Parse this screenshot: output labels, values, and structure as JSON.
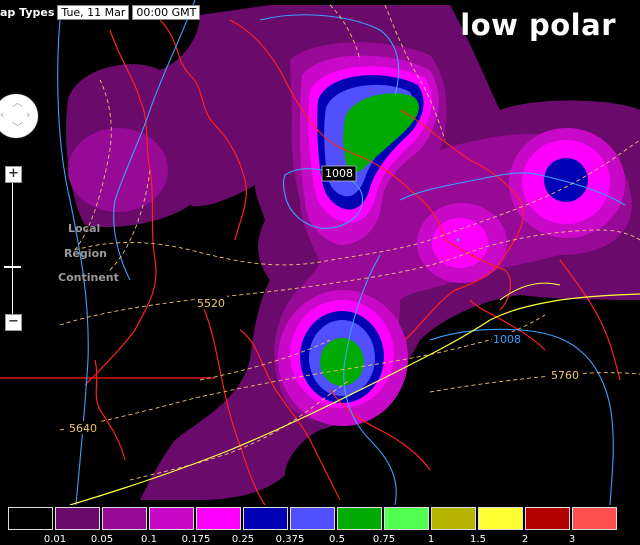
{
  "header": {
    "map_types_label": "ap Types",
    "date": "Tue, 11 Mar",
    "time": "00:00 GMT",
    "title": "low polar"
  },
  "contour_labels": {
    "pressure_low_1": "1008",
    "pressure_low_2": "1008",
    "thickness_5520": "5520",
    "thickness_5640": "5640",
    "thickness_5760": "5760"
  },
  "controls": {
    "zoom_in": "+",
    "zoom_out": "−",
    "level_local": "Local",
    "level_region": "Region",
    "level_continent": "Continent"
  },
  "legend": {
    "colors": [
      "#000000",
      "#6a0a6a",
      "#960a96",
      "#c80ac8",
      "#ff00ff",
      "#0000b4",
      "#5050ff",
      "#00aa00",
      "#50ff50",
      "#b4b400",
      "#ffff32",
      "#b40000",
      "#ff5050"
    ],
    "ticks": [
      "0.01",
      "0.05",
      "0.1",
      "0.175",
      "0.25",
      "0.375",
      "0.5",
      "0.75",
      "1",
      "1.5",
      "2",
      "3"
    ]
  },
  "palette": {
    "coast": "#ff2020",
    "isobar": "#3aa0ff",
    "thickness": "#f0c070",
    "front": "#ffff40"
  }
}
